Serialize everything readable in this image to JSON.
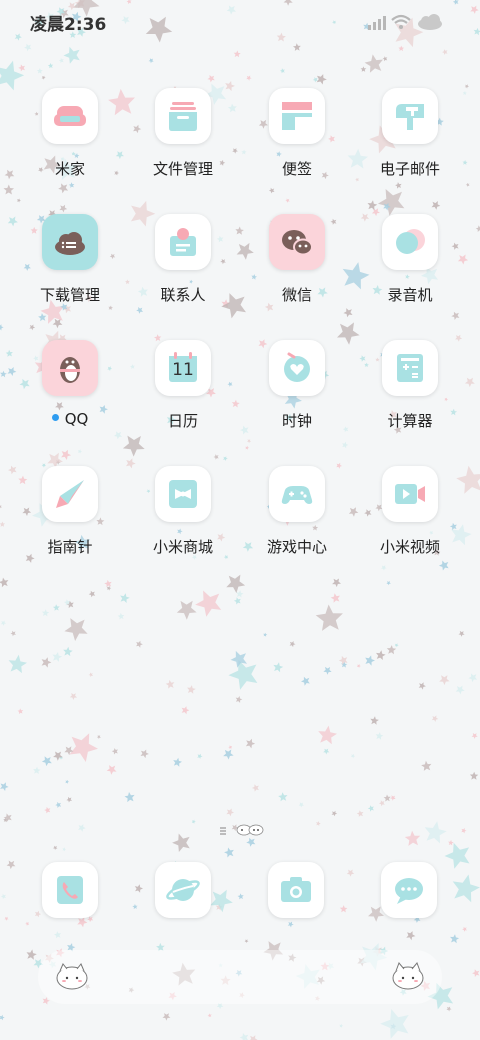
{
  "status_bar": {
    "time": "凌晨2:36",
    "icons": [
      "signal-icon",
      "wifi-icon",
      "cloud-icon"
    ]
  },
  "apps": [
    {
      "label": "米家",
      "icon": "sofa-icon"
    },
    {
      "label": "文件管理",
      "icon": "folder-icon"
    },
    {
      "label": "便签",
      "icon": "notes-icon"
    },
    {
      "label": "电子邮件",
      "icon": "mailbox-icon"
    },
    {
      "label": "下载管理",
      "icon": "cloud-download-icon"
    },
    {
      "label": "联系人",
      "icon": "contact-card-icon"
    },
    {
      "label": "微信",
      "icon": "wechat-icon"
    },
    {
      "label": "录音机",
      "icon": "recorder-icon"
    },
    {
      "label": "QQ",
      "icon": "penguin-icon",
      "notification": true
    },
    {
      "label": "日历",
      "icon": "calendar-icon",
      "calendar_day": "11"
    },
    {
      "label": "时钟",
      "icon": "clock-heart-icon"
    },
    {
      "label": "计算器",
      "icon": "calculator-icon"
    },
    {
      "label": "指南针",
      "icon": "compass-icon"
    },
    {
      "label": "小米商城",
      "icon": "bowtie-bag-icon"
    },
    {
      "label": "游戏中心",
      "icon": "gamepad-icon"
    },
    {
      "label": "小米视频",
      "icon": "video-camera-icon"
    }
  ],
  "dock": [
    {
      "icon": "phone-icon"
    },
    {
      "icon": "planet-browser-icon"
    },
    {
      "icon": "camera-icon"
    },
    {
      "icon": "chat-bubble-icon"
    }
  ],
  "colors": {
    "pink": "#f7a9b4",
    "mint": "#a9e1e3",
    "brown": "#7a5f5a",
    "notification_dot": "#2e9cf0"
  }
}
